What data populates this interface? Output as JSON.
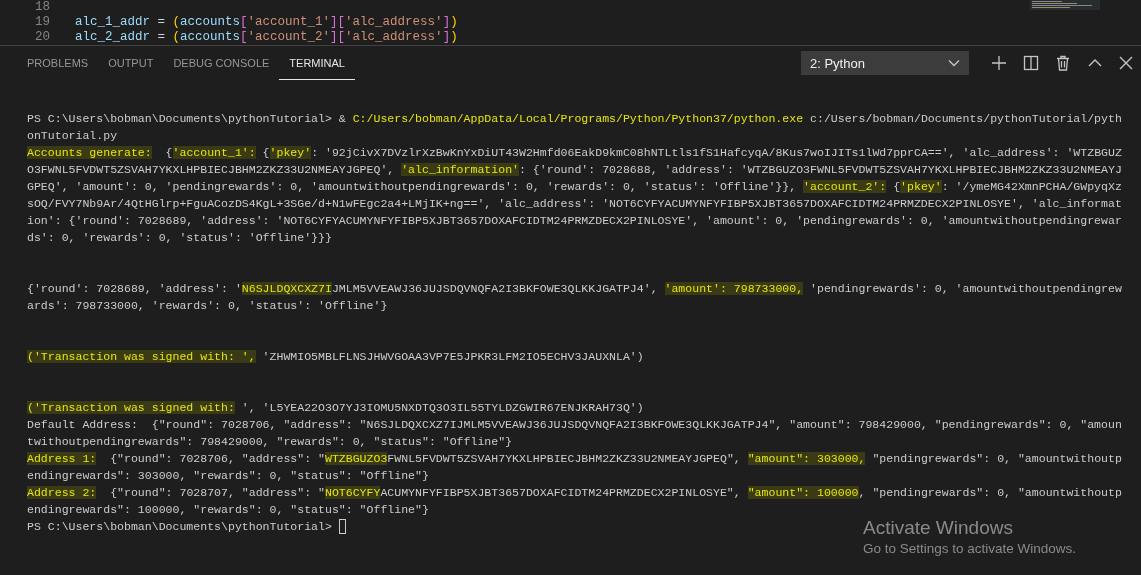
{
  "editor": {
    "lines": [
      {
        "number": "18"
      },
      {
        "number": "19",
        "tokens": [
          {
            "kind": "name",
            "text": "alc_1_addr"
          },
          {
            "kind": "op",
            "text": " = "
          },
          {
            "kind": "paren",
            "text": "("
          },
          {
            "kind": "name",
            "text": "accounts"
          },
          {
            "kind": "bracket",
            "text": "["
          },
          {
            "kind": "string",
            "text": "'account_1'"
          },
          {
            "kind": "bracket",
            "text": "]["
          },
          {
            "kind": "string",
            "text": "'alc_address'"
          },
          {
            "kind": "bracket",
            "text": "]"
          },
          {
            "kind": "paren",
            "text": ")"
          }
        ]
      },
      {
        "number": "20",
        "tokens": [
          {
            "kind": "name",
            "text": "alc_2_addr"
          },
          {
            "kind": "op",
            "text": " = "
          },
          {
            "kind": "paren",
            "text": "("
          },
          {
            "kind": "name",
            "text": "accounts"
          },
          {
            "kind": "bracket",
            "text": "["
          },
          {
            "kind": "string",
            "text": "'account_2'"
          },
          {
            "kind": "bracket",
            "text": "]["
          },
          {
            "kind": "string",
            "text": "'alc_address'"
          },
          {
            "kind": "bracket",
            "text": "]"
          },
          {
            "kind": "paren",
            "text": ")"
          }
        ]
      }
    ]
  },
  "panel": {
    "tabs": [
      {
        "label": "PROBLEMS",
        "selected": false
      },
      {
        "label": "OUTPUT",
        "selected": false
      },
      {
        "label": "DEBUG CONSOLE",
        "selected": false
      },
      {
        "label": "TERMINAL",
        "selected": true
      }
    ],
    "terminal_select": {
      "value": "2: Python"
    }
  },
  "terminal": {
    "lines": [
      {
        "kind": "text",
        "segments": [
          {
            "kind": "plain",
            "text": "PS C:\\Users\\bobman\\Documents\\pythonTutorial> & "
          },
          {
            "kind": "command",
            "text": "C:/Users/bobman/AppData/Local/Programs/Python/Python37/python.exe"
          },
          {
            "kind": "plain",
            "text": " c:/Users/bobman/Documents/pythonTutorial/pyth"
          }
        ]
      },
      {
        "kind": "text",
        "segments": [
          {
            "kind": "plain",
            "text": "onTutorial.py"
          }
        ]
      },
      {
        "kind": "text",
        "segments": [
          {
            "kind": "marked",
            "text": "Accounts generate:"
          },
          {
            "kind": "plain",
            "text": "  {"
          },
          {
            "kind": "marked",
            "text": "'account_1':"
          },
          {
            "kind": "plain",
            "text": " {"
          },
          {
            "kind": "marked",
            "text": "'pkey'"
          },
          {
            "kind": "plain",
            "text": ": '92jCivX7DVzlrXzBwKnYxDiUT43W2Hmfd06EakD9kmC08hNTLtls1fS1HafcyqA/8Kus7woIJITs1lWd7pprCA==', 'alc_address': 'WTZBGUZ"
          }
        ]
      },
      {
        "kind": "text",
        "segments": [
          {
            "kind": "plain",
            "text": "O3FWNL5FVDWT5ZSVAH7YKXLHPBIECJBHM2ZKZ33U2NMEAYJGPEQ', "
          },
          {
            "kind": "marked",
            "text": "'alc_information'"
          },
          {
            "kind": "plain",
            "text": ": {'round': 7028688, 'address': 'WTZBGUZO3FWNL5FVDWT5ZSVAH7YKXLHPBIECJBHM2ZKZ33U2NMEAYJ"
          }
        ]
      },
      {
        "kind": "text",
        "segments": [
          {
            "kind": "plain",
            "text": "GPEQ', 'amount': 0, 'pendingrewards': 0, 'amountwithoutpendingrewards': 0, 'rewards': 0, 'status': 'Offline'}}, "
          },
          {
            "kind": "marked",
            "text": "'account_2':"
          },
          {
            "kind": "plain",
            "text": " {"
          },
          {
            "kind": "marked",
            "text": "'pkey'"
          },
          {
            "kind": "plain",
            "text": ": '/ymeMG42XmnPCHA/GWpyqXz"
          }
        ]
      },
      {
        "kind": "text",
        "segments": [
          {
            "kind": "plain",
            "text": "sOQ/FVY7Nb9Ar/4QtHGlrp+FguACozDS4KgL+3SGe/d+N1wFEgc2a4+LMjIK+ng==', 'alc_address': 'NOT6CYFYACUMYNFYFIBP5XJBT3657DOXAFCIDTM24PRMZDECX2PINLOSYE', 'alc_informat"
          }
        ]
      },
      {
        "kind": "text",
        "segments": [
          {
            "kind": "plain",
            "text": "ion': {'round': 7028689, 'address': 'NOT6CYFYACUMYNFYFIBP5XJBT3657DOXAFCIDTM24PRMZDECX2PINLOSYE', 'amount': 0, 'pendingrewards': 0, 'amountwithoutpendingrewar"
          }
        ]
      },
      {
        "kind": "text",
        "segments": [
          {
            "kind": "plain",
            "text": "ds': 0, 'rewards': 0, 'status': 'Offline'}}}"
          }
        ]
      },
      {
        "kind": "blank"
      },
      {
        "kind": "blank"
      },
      {
        "kind": "text",
        "segments": [
          {
            "kind": "plain",
            "text": "{'round': 7028689, 'address': '"
          },
          {
            "kind": "marked",
            "text": "N6SJLDQXCXZ7I"
          },
          {
            "kind": "plain",
            "text": "JMLM5VVEAWJ36JUJSDQVNQFA2I3BKFOWE3QLKKJGATPJ4', "
          },
          {
            "kind": "marked",
            "text": "'amount': 798733000,"
          },
          {
            "kind": "plain",
            "text": " 'pendingrewards': 0, 'amountwithoutpendingrew"
          }
        ]
      },
      {
        "kind": "text",
        "segments": [
          {
            "kind": "plain",
            "text": "ards': 798733000, 'rewards': 0, 'status': 'Offline'}"
          }
        ]
      },
      {
        "kind": "blank"
      },
      {
        "kind": "blank"
      },
      {
        "kind": "text",
        "segments": [
          {
            "kind": "marked",
            "text": "('Transaction was signed with: ',"
          },
          {
            "kind": "plain",
            "text": " 'ZHWMIO5MBLFLNSJHWVGOAA3VP7E5JPKR3LFM2IO5ECHV3JAUXNLA')"
          }
        ]
      },
      {
        "kind": "blank"
      },
      {
        "kind": "blank"
      },
      {
        "kind": "text",
        "segments": [
          {
            "kind": "marked",
            "text": "('Transaction was signed with:"
          },
          {
            "kind": "plain",
            "text": " ', 'L5YEA22O3O7YJ3IOMU5NXDTQ3O3IL55TYLDZGWIR67ENJKRAH73Q')"
          }
        ]
      },
      {
        "kind": "text",
        "segments": [
          {
            "kind": "plain",
            "text": "Default Address:  {\"round\": 7028706, \"address\": \"N6SJLDQXCXZ7IJMLM5VVEAWJ36JUJSDQVNQFA2I3BKFOWE3QLKKJGATPJ4\", \"amount\": 798429000, \"pendingrewards\": 0, \"amoun"
          }
        ]
      },
      {
        "kind": "text",
        "segments": [
          {
            "kind": "plain",
            "text": "twithoutpendingrewards\": 798429000, \"rewards\": 0, \"status\": \"Offline\"}"
          }
        ]
      },
      {
        "kind": "text",
        "segments": [
          {
            "kind": "marked",
            "text": "Address 1:"
          },
          {
            "kind": "plain",
            "text": "  {\"round\": 7028706, \"address\": \""
          },
          {
            "kind": "marked",
            "text": "WTZBGUZO3"
          },
          {
            "kind": "plain",
            "text": "FWNL5FVDWT5ZSVAH7YKXLHPBIECJBHM2ZKZ33U2NMEAYJGPEQ\", "
          },
          {
            "kind": "marked",
            "text": "\"amount\": 303000,"
          },
          {
            "kind": "plain",
            "text": " \"pendingrewards\": 0, \"amountwithoutp"
          }
        ]
      },
      {
        "kind": "text",
        "segments": [
          {
            "kind": "plain",
            "text": "endingrewards\": 303000, \"rewards\": 0, \"status\": \"Offline\"}"
          }
        ]
      },
      {
        "kind": "text",
        "segments": [
          {
            "kind": "marked",
            "text": "Address 2:"
          },
          {
            "kind": "plain",
            "text": "  {\"round\": 7028707, \"address\": \""
          },
          {
            "kind": "marked",
            "text": "NOT6CYFY"
          },
          {
            "kind": "plain",
            "text": "ACUMYNFYFIBP5XJBT3657DOXAFCIDTM24PRMZDECX2PINLOSYE\", "
          },
          {
            "kind": "marked",
            "text": "\"amount\": 100000"
          },
          {
            "kind": "plain",
            "text": ", \"pendingrewards\": 0, \"amountwithoutp"
          }
        ]
      },
      {
        "kind": "text",
        "segments": [
          {
            "kind": "plain",
            "text": "endingrewards\": 100000, \"rewards\": 0, \"status\": \"Offline\"}"
          }
        ]
      },
      {
        "kind": "prompt",
        "segments": [
          {
            "kind": "plain",
            "text": "PS C:\\Users\\bobman\\Documents\\pythonTutorial> "
          }
        ]
      }
    ]
  },
  "activation_notice": {
    "title": "Activate Windows",
    "message": "Go to Settings to activate Windows."
  }
}
